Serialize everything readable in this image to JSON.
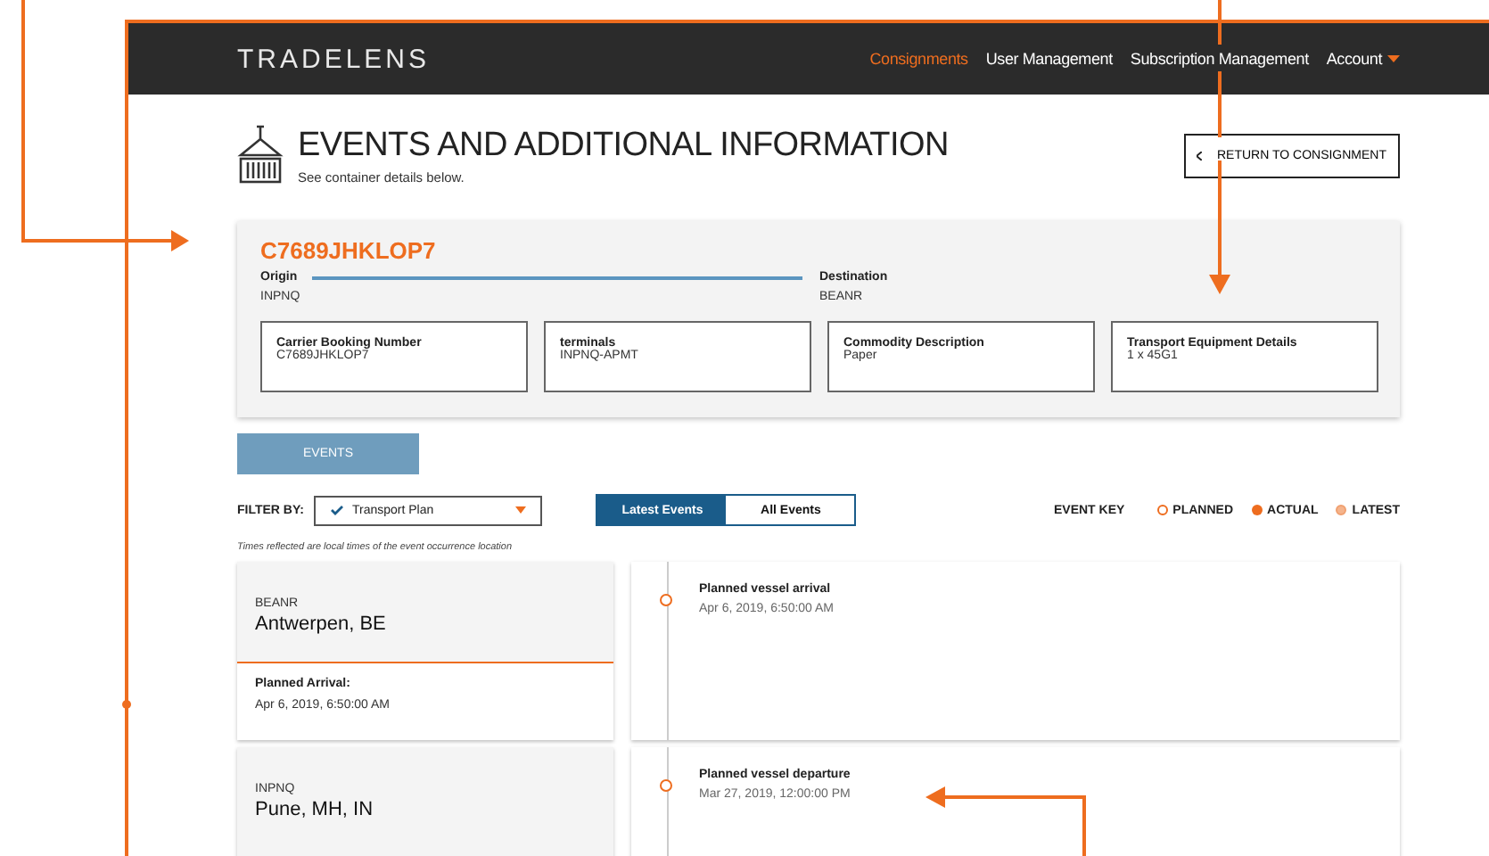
{
  "header": {
    "logo": "TRADELENS",
    "nav": [
      {
        "label": "Consignments",
        "selected": true
      },
      {
        "label": "User Management",
        "selected": false
      },
      {
        "label": "Subscription Management",
        "selected": false
      },
      {
        "label": "Account",
        "selected": false,
        "kind": "menu"
      }
    ]
  },
  "page": {
    "title": "EVENTS AND ADDITIONAL INFORMATION",
    "subtitle": "See container details below.",
    "return_button": "RETURN TO CONSIGNMENT"
  },
  "shipment": {
    "id": "C7689JHKLOP7",
    "origin_label": "Origin",
    "origin": "INPNQ",
    "destination_label": "Destination",
    "destination": "BEANR",
    "details": [
      {
        "label": "Carrier Booking Number",
        "value": "C7689JHKLOP7"
      },
      {
        "label": "terminals",
        "value": "INPNQ-APMT"
      },
      {
        "label": "Commodity Description",
        "value": "Paper"
      },
      {
        "label": "Transport Equipment Details",
        "value": "1 x 45G1"
      }
    ]
  },
  "tabs": [
    {
      "label": "EVENTS",
      "selected": true
    }
  ],
  "filter": {
    "label": "FILTER BY:",
    "value": "Transport Plan"
  },
  "view_toggle": [
    {
      "label": "Latest Events",
      "selected": true
    },
    {
      "label": "All Events",
      "selected": false
    }
  ],
  "event_key": {
    "label": "EVENT KEY",
    "items": [
      {
        "label": "PLANNED",
        "kind": "planned"
      },
      {
        "label": "ACTUAL",
        "kind": "actual"
      },
      {
        "label": "LATEST",
        "kind": "latest"
      }
    ]
  },
  "note": "Times reflected are local times of the event occurrence location",
  "locations": [
    {
      "code": "BEANR",
      "name": "Antwerpen, BE",
      "event_label": "Planned Arrival:",
      "event_time": "Apr 6, 2019, 6:50:00 AM",
      "events": [
        {
          "title": "Planned vessel arrival",
          "time": "Apr 6, 2019, 6:50:00 AM",
          "kind": "planned"
        }
      ]
    },
    {
      "code": "INPNQ",
      "name": "Pune, MH, IN",
      "events": [
        {
          "title": "Planned vessel departure",
          "time": "Mar 27, 2019, 12:00:00 PM",
          "kind": "planned"
        }
      ]
    }
  ]
}
